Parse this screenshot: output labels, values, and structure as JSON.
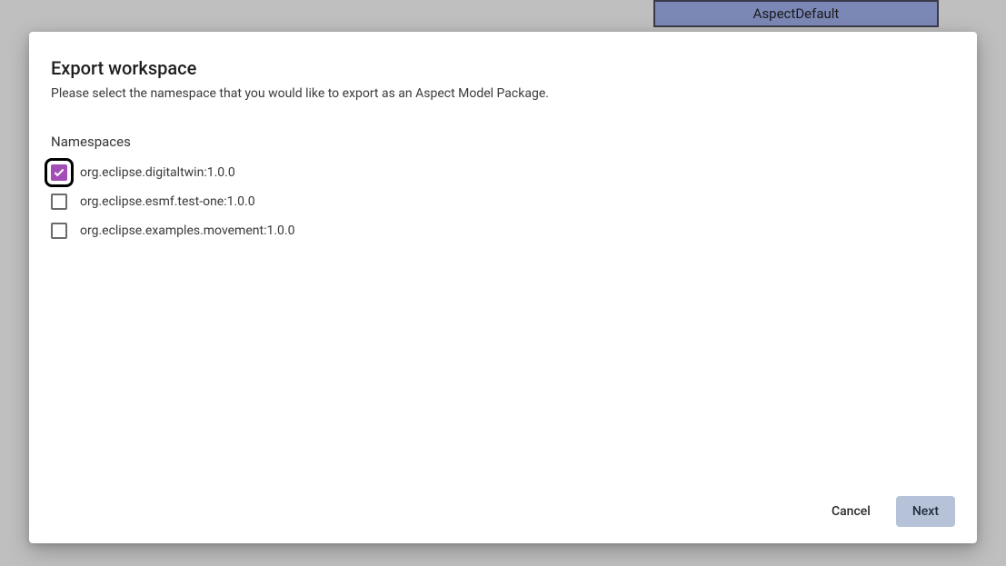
{
  "background": {
    "node_label": "AspectDefault"
  },
  "modal": {
    "title": "Export workspace",
    "subtitle": "Please select the namespace that you would like to export as an Aspect Model Package.",
    "section_label": "Namespaces",
    "namespaces": [
      {
        "label": "org.eclipse.digitaltwin:1.0.0",
        "checked": true,
        "highlight": true
      },
      {
        "label": "org.eclipse.esmf.test-one:1.0.0",
        "checked": false,
        "highlight": false
      },
      {
        "label": "org.eclipse.examples.movement:1.0.0",
        "checked": false,
        "highlight": false
      }
    ],
    "buttons": {
      "cancel": "Cancel",
      "next": "Next"
    }
  }
}
